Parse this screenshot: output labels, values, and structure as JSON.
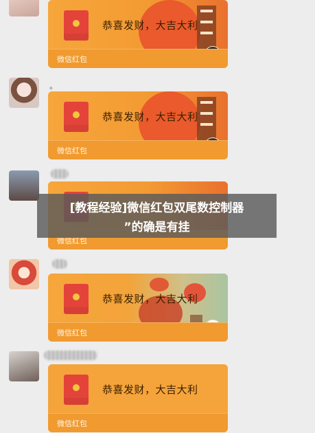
{
  "messages": [
    {
      "sender_nickname": "",
      "packet_message": "恭喜发财，大吉大利",
      "packet_label": "微信红包",
      "background_theme": "orange-lantern"
    },
    {
      "sender_nickname": "。",
      "packet_message": "恭喜发财，大吉大利",
      "packet_label": "微信红包",
      "background_theme": "orange-lantern"
    },
    {
      "sender_nickname": "",
      "packet_message": "",
      "packet_label": "微信红包",
      "background_theme": "orange-lantern"
    },
    {
      "sender_nickname": "",
      "packet_message": "恭喜发财，大吉大利",
      "packet_label": "微信红包",
      "background_theme": "green-lantern"
    },
    {
      "sender_nickname": "",
      "packet_message": "恭喜发财，大吉大利",
      "packet_label": "微信红包",
      "background_theme": "plain-orange"
    }
  ],
  "overlay": {
    "line1": "[教程经验]微信红包双尾数控制器",
    "line2": "”的确是有挂"
  },
  "colors": {
    "background": "#ededed",
    "packet_orange": "#f4a23c",
    "packet_icon_red": "#e4433a",
    "overlay": "#5a5a5a"
  },
  "icons": [
    "red-packet-icon",
    "avatar",
    "lantern-decoration"
  ]
}
